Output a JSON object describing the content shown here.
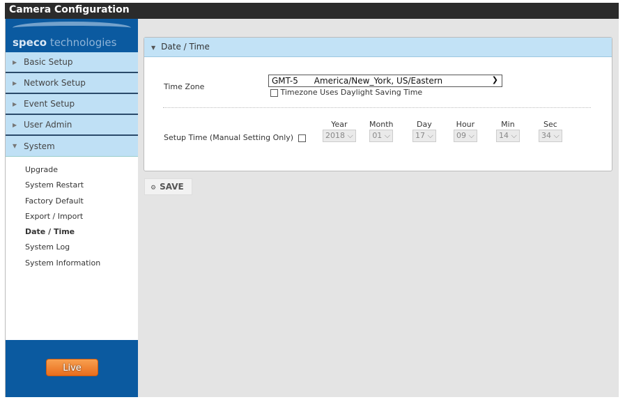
{
  "window": {
    "title": "Camera Configuration"
  },
  "logo": {
    "brand_bold": "speco",
    "brand_light": " technologies"
  },
  "sidebar": {
    "items": [
      {
        "label": "Basic Setup"
      },
      {
        "label": "Network Setup"
      },
      {
        "label": "Event Setup"
      },
      {
        "label": "User Admin"
      },
      {
        "label": "System",
        "expanded": true
      }
    ],
    "submenu": [
      {
        "label": "Upgrade"
      },
      {
        "label": "System Restart"
      },
      {
        "label": "Factory Default"
      },
      {
        "label": "Export / Import"
      },
      {
        "label": "Date / Time",
        "active": true
      },
      {
        "label": "System Log"
      },
      {
        "label": "System Information"
      }
    ],
    "live_label": "Live"
  },
  "panel": {
    "title": "Date / Time",
    "timezone_label": "Time Zone",
    "timezone_value": "GMT-5      America/New_York, US/Eastern",
    "dst_label": "Timezone Uses Daylight Saving Time",
    "dst_checked": false,
    "setup_label": "Setup Time (Manual Setting Only)",
    "setup_checked": false,
    "fields": [
      {
        "label": "Year",
        "value": "2018"
      },
      {
        "label": "Month",
        "value": "01"
      },
      {
        "label": "Day",
        "value": "17"
      },
      {
        "label": "Hour",
        "value": "09"
      },
      {
        "label": "Min",
        "value": "14"
      },
      {
        "label": "Sec",
        "value": "34"
      }
    ]
  },
  "save_label": "SAVE",
  "colors": {
    "brand_blue": "#0b5aa0",
    "menu_bg": "#bfe0f5",
    "live_orange": "#ef7a2a",
    "title_bar": "#2b2b2b"
  }
}
